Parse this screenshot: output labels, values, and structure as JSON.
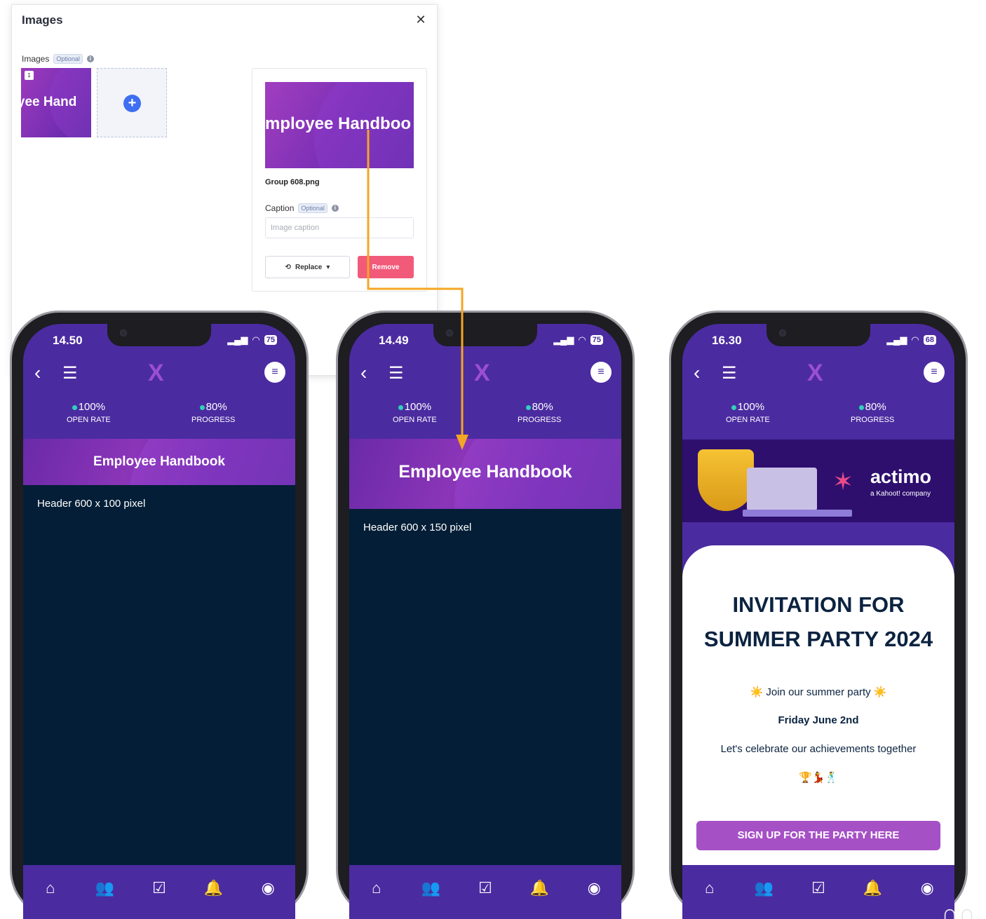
{
  "panel": {
    "title": "Images",
    "close_icon": "close-icon",
    "images_label": "Images",
    "optional_badge": "Optional",
    "thumb_index": "1",
    "thumb_text": "loyee Hand",
    "add_icon": "plus-icon",
    "preview_text": "mployee Handboo",
    "file_name": "Group 608.png",
    "caption_label": "Caption",
    "caption_optional": "Optional",
    "caption_placeholder": "Image caption",
    "replace_label": "Replace",
    "remove_label": "Remove"
  },
  "phones": [
    {
      "time": "14.50",
      "battery": "75",
      "open_rate": "100%",
      "open_rate_label": "OPEN RATE",
      "progress": "80%",
      "progress_label": "PROGRESS",
      "banner_title": "Employee Handbook",
      "content_text": "Header 600 x 100 pixel"
    },
    {
      "time": "14.49",
      "battery": "75",
      "open_rate": "100%",
      "open_rate_label": "OPEN RATE",
      "progress": "80%",
      "progress_label": "PROGRESS",
      "banner_title": "Employee Handbook",
      "content_text": "Header 600 x 150 pixel"
    },
    {
      "time": "16.30",
      "battery": "68",
      "open_rate": "100%",
      "open_rate_label": "OPEN RATE",
      "progress": "80%",
      "progress_label": "PROGRESS",
      "brand_name": "actimo",
      "brand_sub": "a Kahoot! company",
      "invitation_title_1": "INVITATION FOR",
      "invitation_title_2": "SUMMER PARTY 2024",
      "line_1": "☀️ Join our summer party ☀️",
      "line_2": "Friday June 2nd",
      "line_3": "Let's celebrate our achievements together",
      "line_4": "🏆💃🕺",
      "signup_label": "SIGN UP FOR THE PARTY HERE"
    }
  ],
  "colors": {
    "app_purple": "#4b2ba0",
    "dark_content": "#031e36",
    "accent_teal": "#2fd1b8",
    "remove_red": "#f25a7a",
    "connector_orange": "#f5a623",
    "signup_purple": "#a650c6"
  },
  "tabbar_icons": [
    "home-icon",
    "people-icon",
    "tasks-icon",
    "bell-icon",
    "profile-icon"
  ]
}
